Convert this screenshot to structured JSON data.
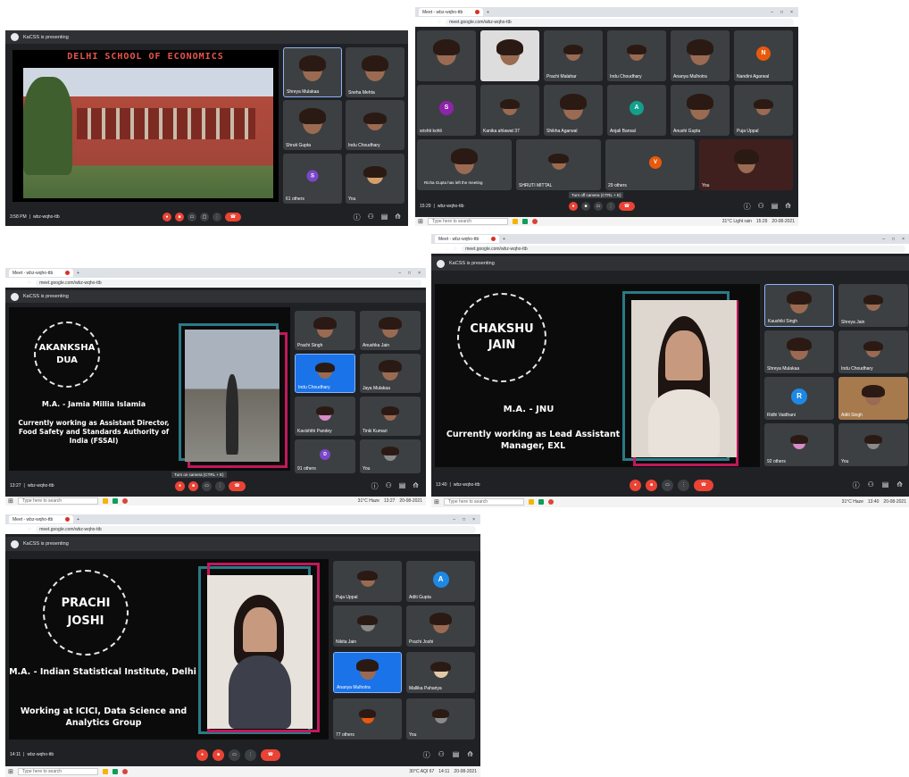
{
  "s1": {
    "presenting": "KaCSS is presenting",
    "slide_title": "DELHI SCHOOL OF ECONOMICS",
    "time": "3:58 PM",
    "code": "wbz-wqho-ttb",
    "tiles": [
      {
        "name": "Shreya Mulakaa"
      },
      {
        "name": "Sneha Mehta"
      },
      {
        "name": "Shruti Gupta"
      },
      {
        "name": "Indu Choudhary"
      },
      {
        "name": "61 others"
      },
      {
        "name": "You"
      }
    ]
  },
  "s2": {
    "time": "15:29",
    "code": "wbz-wqho-ttb",
    "tooltip": "Turn off camera (CTRL + E)",
    "toast": "Richa Gupta has left the meeting",
    "url": "meet.google.com/wbz-wqho-ttb",
    "tab": "Meet - wbz-wqho-ttb",
    "tiles": [
      {
        "name": ""
      },
      {
        "name": ""
      },
      {
        "name": "Prachi Malahar"
      },
      {
        "name": "Indu Choudhary"
      },
      {
        "name": "Ananya Mulhotra"
      },
      {
        "name": "Nandini Agarwal",
        "letter": "N"
      },
      {
        "name": "srishti kohli",
        "letter": "S"
      },
      {
        "name": "Kanika ahlawat 37"
      },
      {
        "name": "Shikha Agarwal"
      },
      {
        "name": "Anjali Bansal",
        "letter": "A"
      },
      {
        "name": "Anushi Gupta"
      },
      {
        "name": "Puja Uppal"
      },
      {
        "name": ""
      },
      {
        "name": "SHRUTI MITTAL"
      },
      {
        "name": "29 others",
        "letter": "V"
      },
      {
        "name": "You"
      }
    ],
    "search": "Type here to search",
    "weather": "31°C Light rain",
    "clock": "15:29",
    "date": "20-08-2021"
  },
  "s3": {
    "presenting": "KaCSS is presenting",
    "tab": "Meet - wbz-wqho-ttb",
    "url": "meet.google.com/wbz-wqho-ttb",
    "name_line1": "AKANKSHA",
    "name_line2": "DUA",
    "degree": "M.A. - Jamia Millia Islamia",
    "work": "Currently working as Assistant Director, Food Safety and Standards Authority of India (FSSAI)",
    "time": "13:27",
    "code": "wbz-wqho-ttb",
    "tooltip": "Turn on camera (CTRL + E)",
    "tiles": [
      {
        "name": "Prachi Singh"
      },
      {
        "name": "Anushka Jain"
      },
      {
        "name": "Indu Choudhary"
      },
      {
        "name": "Jaya Mulakaa"
      },
      {
        "name": "Kavishthi Pandey"
      },
      {
        "name": "Tinki Kumari"
      },
      {
        "name": "91 others"
      },
      {
        "name": "You"
      }
    ],
    "search": "Type here to search",
    "weather": "31°C Haze",
    "clock": "13:27",
    "date": "20-08-2021"
  },
  "s4": {
    "presenting": "KaCSS is presenting",
    "tab": "Meet - wbz-wqho-ttb",
    "url": "meet.google.com/wbz-wqho-ttb",
    "name_line1": "CHAKSHU",
    "name_line2": "JAIN",
    "degree": "M.A. - JNU",
    "work": "Currently working as Lead Assistant Manager, EXL",
    "time": "13:40",
    "code": "wbz-wqho-ttb",
    "tiles": [
      {
        "name": "Kaushiki Singh"
      },
      {
        "name": "Shreya Jain"
      },
      {
        "name": "Shreya Mulakaa"
      },
      {
        "name": "Indu Choudhary"
      },
      {
        "name": "Ridhi Vaidhani",
        "letter": "R"
      },
      {
        "name": "Aditi Singh"
      },
      {
        "name": "92 others"
      },
      {
        "name": "You"
      }
    ],
    "search": "Type here to search",
    "weather": "31°C Haze",
    "clock": "13:40",
    "date": "20-08-2021"
  },
  "s5": {
    "presenting": "KaCSS is presenting",
    "tab": "Meet - wbz-wqho-ttb",
    "url": "meet.google.com/wbz-wqho-ttb",
    "name_line1": "PRACHI",
    "name_line2": "JOSHI",
    "degree": "M.A. - Indian Statistical Institute, Delhi",
    "work": "Working at ICICI, Data Science and Analytics Group",
    "time": "14:11",
    "code": "wbz-wqho-ttb",
    "tiles": [
      {
        "name": "Puja Uppal"
      },
      {
        "name": "Aditi Gupta",
        "letter": "A"
      },
      {
        "name": "Nikita Jain"
      },
      {
        "name": "Prachi Joshi"
      },
      {
        "name": "Ananya Mulhotra"
      },
      {
        "name": "Mallika Pahariya"
      },
      {
        "name": "77 others"
      },
      {
        "name": "You"
      }
    ],
    "search": "Type here to search",
    "weather": "30°C AQI 67",
    "clock": "14:11",
    "date": "20-08-2021"
  }
}
